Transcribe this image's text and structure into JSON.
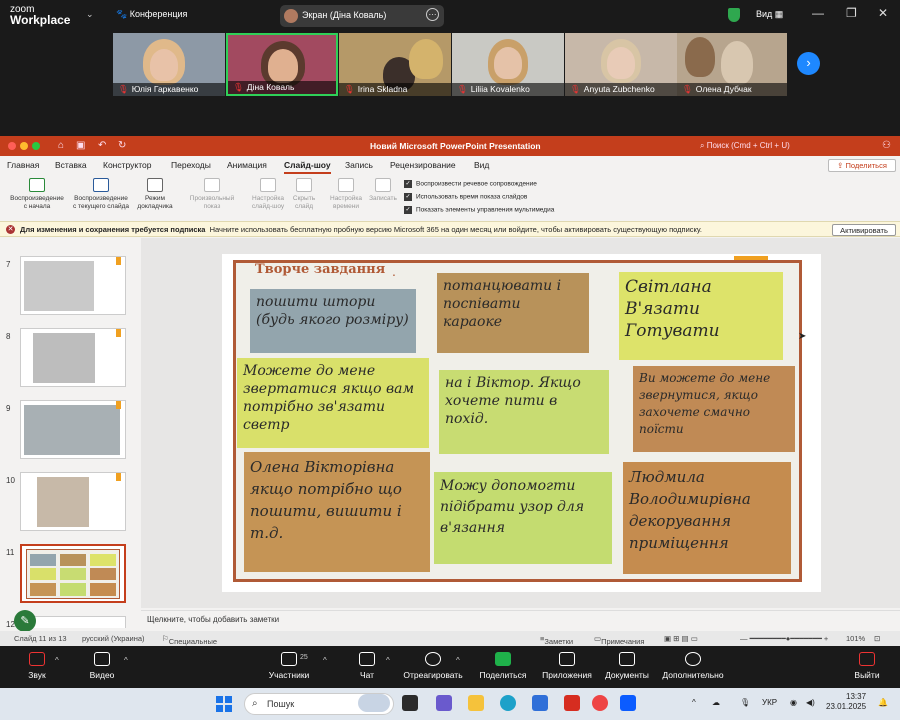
{
  "zoom": {
    "logo_line1": "zoom",
    "logo_line2": "Workplace",
    "conference_label": "Конференция",
    "screen_share_label": "Экран (Діна Коваль)",
    "view_label": "Вид",
    "participants": [
      {
        "name": "Юлія Гаркавенко"
      },
      {
        "name": "Діна Коваль"
      },
      {
        "name": "Irina Skladna"
      },
      {
        "name": "Liliia Kovalenko"
      },
      {
        "name": "Anyuta Zubchenko"
      },
      {
        "name": "Олена Дубчак"
      }
    ],
    "controls": {
      "audio": "Звук",
      "video": "Видео",
      "participants": "Участники",
      "participants_count": "25",
      "chat": "Чат",
      "react": "Отреагировать",
      "share": "Поделиться",
      "apps": "Приложения",
      "docs": "Документы",
      "more": "Дополнительно",
      "leave": "Выйти"
    }
  },
  "ppt": {
    "title": "Новий Microsoft PowerPoint Presentation",
    "search": "Поиск (Cmd + Ctrl + U)",
    "tabs": [
      "Главная",
      "Вставка",
      "Конструктор",
      "Переходы",
      "Анимация",
      "Слайд-шоу",
      "Запись",
      "Рецензирование",
      "Вид"
    ],
    "share_button": "Поделиться",
    "ribbon": {
      "from_start_1": "Воспроизведение",
      "from_start_2": "с начала",
      "from_current_1": "Воспроизведение",
      "from_current_2": "с текущего слайда",
      "presenter_1": "Режим",
      "presenter_2": "докладчика",
      "custom_1": "Произвольный",
      "custom_2": "показ",
      "setup_1": "Настройка",
      "setup_2": "слайд-шоу",
      "hide_1": "Скрыть",
      "hide_2": "слайд",
      "timing_1": "Настройка",
      "timing_2": "времени",
      "record": "Записать",
      "check_narration": "Воспроизвести речевое сопровождение",
      "check_timings": "Использовать время показа слайдов",
      "check_media": "Показать элементы управления мультимедиа"
    },
    "notice": {
      "bold": "Для изменения и сохранения требуется подписка",
      "text": "Начните использовать бесплатную пробную версию Microsoft 365 на один месяц или войдите, чтобы активировать существующую подписку.",
      "activate": "Активировать"
    },
    "slide_numbers": [
      "7",
      "8",
      "9",
      "10",
      "11",
      "12"
    ],
    "slide": {
      "title": "Творче завдання",
      "title_dot": ".",
      "notes": [
        "пошити штори (будь якого розміру)",
        "потанцювати і поспівати караоке",
        "Світлана В'язати Готувати",
        "Можете до мене звертатися якщо вам потрібно зв'язати светр",
        "на і Віктор. Якщо хочете пити в похід.",
        "Ви можете до мене звернутися, якщо захочете смачно поїсти",
        "Олена Вікторівна якщо потрібно що пошити, вишити і т.д.",
        "Можу допомогти підібрати узор для в'язання",
        "Людмила Володимирівна декорування приміщення"
      ]
    },
    "notes_placeholder": "Щелкните, чтобы добавить заметки",
    "status": {
      "slide_of": "Слайд 11 из 13",
      "language": "русский (Украина)",
      "accessibility": "Специальные возможности: не поддерживаются",
      "notes": "Заметки",
      "comments": "Примечания",
      "zoom": "101%"
    }
  },
  "taskbar": {
    "search": "Пошук",
    "lang": "УКР",
    "time": "13:37",
    "date": "23.01.2025"
  }
}
